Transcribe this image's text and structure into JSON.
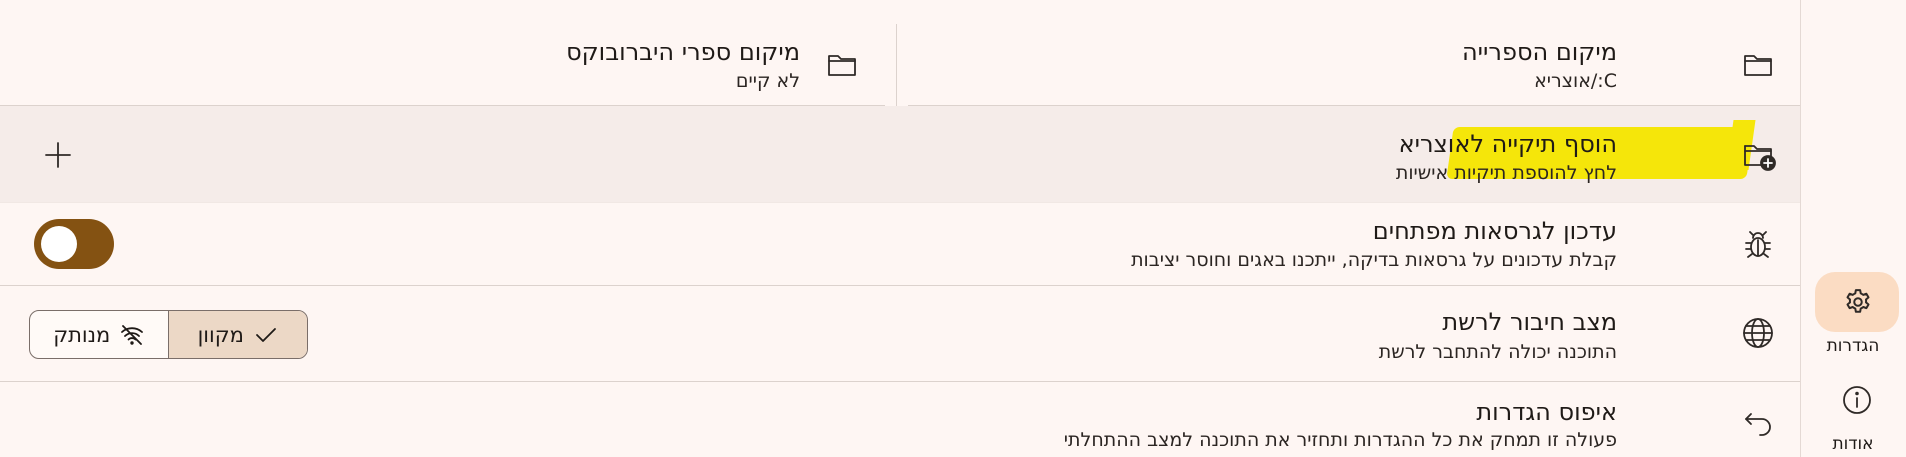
{
  "settings": {
    "library_location": {
      "title": "מיקום הספרייה",
      "subtitle": "C:/אוצריא"
    },
    "hebrewbooks_location": {
      "title": "מיקום ספרי היברובוקס",
      "subtitle": "לא קיים"
    },
    "add_folder": {
      "title": "הוסף תיקייה לאוצריא",
      "subtitle": "לחץ להוספת תיקיות אישיות"
    },
    "dev_updates": {
      "title": "עדכון לגרסאות מפתחים",
      "subtitle": "קבלת עדכונים על גרסאות בדיקה, ייתכנו באגים וחוסר יציבות",
      "enabled": true
    },
    "network": {
      "title": "מצב חיבור לרשת",
      "subtitle": "התוכנה יכולה להתחבר לרשת",
      "online_label": "מקוון",
      "offline_label": "מנותק",
      "selected": "מקוון"
    },
    "reset": {
      "title": "איפוס הגדרות",
      "subtitle": "פעולה זו תמחק את כל ההגדרות ותחזיר את התוכנה למצב ההתחלתי"
    }
  },
  "sidebar": {
    "items": [
      {
        "label": "הגדרות",
        "icon": "gear-icon",
        "active": true
      },
      {
        "label": "אודות",
        "icon": "info-icon",
        "active": false
      }
    ]
  },
  "colors": {
    "background": "#fef6f3",
    "accent": "#845212",
    "active_nav": "#fbdcc3",
    "highlight": "#f5e60a"
  }
}
